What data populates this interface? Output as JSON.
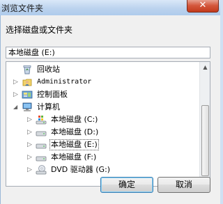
{
  "window": {
    "title": "浏览文件夹",
    "close_label": "✕"
  },
  "prompt": "选择磁盘或文件夹",
  "path": {
    "value": "本地磁盘 (E:)"
  },
  "tree": {
    "items": [
      {
        "label": "回收站",
        "icon": "recycle-bin-icon",
        "expander": ""
      },
      {
        "label": "Administrator",
        "icon": "user-folder-icon",
        "expander": "▷"
      },
      {
        "label": "控制面板",
        "icon": "control-panel-icon",
        "expander": "▷"
      },
      {
        "label": "计算机",
        "icon": "computer-icon",
        "expander": "◢"
      },
      {
        "label": "本地磁盘 (C:)",
        "icon": "system-drive-icon",
        "expander": "▷"
      },
      {
        "label": "本地磁盘 (D:)",
        "icon": "drive-icon",
        "expander": "▷"
      },
      {
        "label": "本地磁盘 (E:)",
        "icon": "drive-icon",
        "expander": "▷",
        "selected": true
      },
      {
        "label": "本地磁盘 (F:)",
        "icon": "drive-icon",
        "expander": "▷"
      },
      {
        "label": "DVD 驱动器 (G:)",
        "icon": "dvd-drive-icon",
        "expander": "▷"
      }
    ]
  },
  "buttons": {
    "ok": "确定",
    "cancel": "取消"
  },
  "colors": {
    "selection_border": "#555555",
    "title_bar": "#bcd3ee",
    "close_button": "#c23a1c"
  }
}
